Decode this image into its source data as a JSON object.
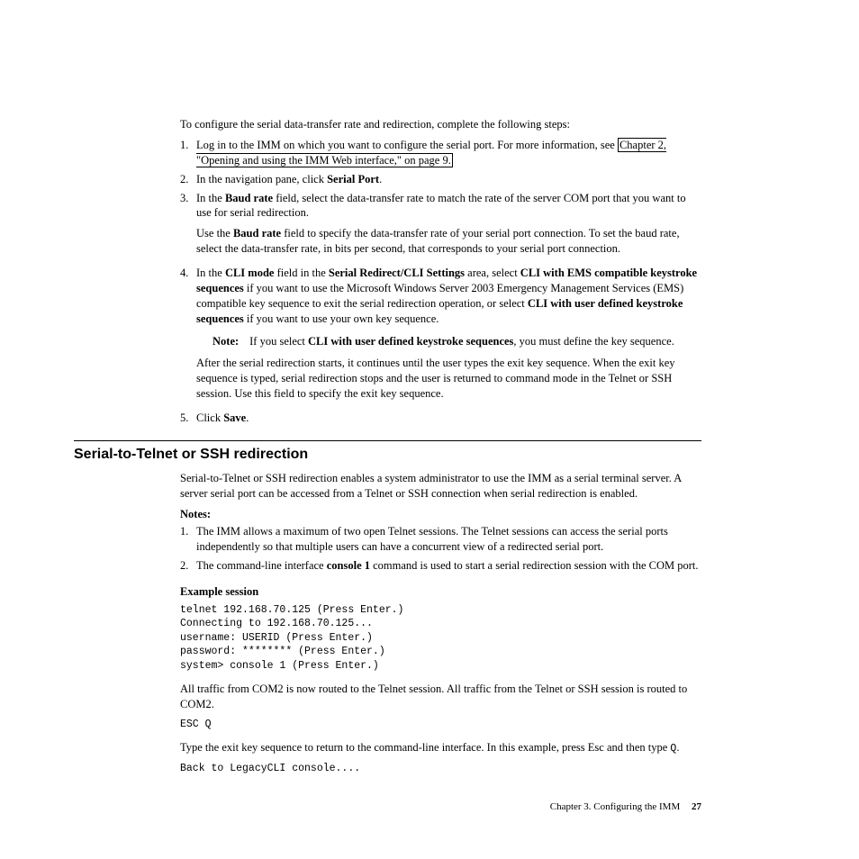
{
  "intro": "To configure the serial data-transfer rate and redirection, complete the following steps:",
  "steps": [
    {
      "num": "1.",
      "pre": "Log in to the IMM on which you want to configure the serial port. For more information, see ",
      "link": "Chapter 2, \"Opening and using the IMM Web interface,\" on page 9."
    },
    {
      "num": "2.",
      "pre": "In the navigation pane, click ",
      "b1": "Serial Port",
      "post": "."
    },
    {
      "num": "3.",
      "pre": "In the ",
      "b1": "Baud rate",
      "mid": " field, select the data-transfer rate to match the rate of the server COM port that you want to use for serial redirection.",
      "p2_pre": "Use the ",
      "p2_b": "Baud rate",
      "p2_post": " field to specify the data-transfer rate of your serial port connection. To set the baud rate, select the data-transfer rate, in bits per second, that corresponds to your serial port connection."
    },
    {
      "num": "4.",
      "s4_t1": "In the ",
      "s4_b1": "CLI mode",
      "s4_t2": " field in the ",
      "s4_b2": "Serial Redirect/CLI Settings",
      "s4_t3": " area, select ",
      "s4_b3": "CLI with EMS compatible keystroke sequences",
      "s4_t4": " if you want to use the Microsoft Windows Server 2003 Emergency Management Services (EMS) compatible key sequence to exit the serial redirection operation, or select ",
      "s4_b4": "CLI with user defined keystroke sequences",
      "s4_t5": " if you want to use your own key sequence.",
      "note_label": "Note:",
      "note_t1": "If you select ",
      "note_b": "CLI with user defined keystroke sequences",
      "note_t2": ", you must define the key sequence.",
      "after": "After the serial redirection starts, it continues until the user types the exit key sequence. When the exit key sequence is typed, serial redirection stops and the user is returned to command mode in the Telnet or SSH session. Use this field to specify the exit key sequence."
    },
    {
      "num": "5.",
      "pre": "Click ",
      "b1": "Save",
      "post": "."
    }
  ],
  "section_heading": "Serial-to-Telnet or SSH redirection",
  "section_intro": "Serial-to-Telnet or SSH redirection enables a system administrator to use the IMM as a serial terminal server. A server serial port can be accessed from a Telnet or SSH connection when serial redirection is enabled.",
  "notes_heading": "Notes:",
  "notes": [
    {
      "num": "1.",
      "text": "The IMM allows a maximum of two open Telnet sessions. The Telnet sessions can access the serial ports independently so that multiple users can have a concurrent view of a redirected serial port."
    },
    {
      "num": "2.",
      "t1": "The command-line interface ",
      "b": "console 1",
      "t2": " command is used to start a serial redirection session with the COM port."
    }
  ],
  "example_heading": "Example session",
  "code1": "telnet 192.168.70.125 (Press Enter.)\nConnecting to 192.168.70.125...\nusername: USERID (Press Enter.)\npassword: ******** (Press Enter.)\nsystem> console 1 (Press Enter.)",
  "para_traffic": "All traffic from COM2 is now routed to the Telnet session. All traffic from the Telnet or SSH session is routed to COM2.",
  "code2": "ESC Q",
  "para_exit_t1": "Type the exit key sequence to return to the command-line interface. In this example, press Esc and then type ",
  "para_exit_code": "Q",
  "para_exit_t2": ".",
  "code3": "Back to LegacyCLI console....",
  "footer_text": "Chapter 3. Configuring the IMM",
  "footer_page": "27"
}
